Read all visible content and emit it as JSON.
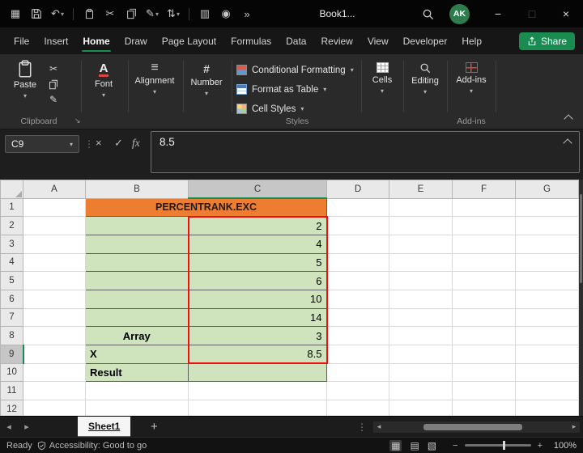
{
  "colors": {
    "accent_green": "#1a8c52",
    "cell_green": "#cfe3bd",
    "cell_orange": "#ed7d31",
    "range_red": "#ee1111"
  },
  "icons": {
    "dropdown": "▾",
    "overflow": "»",
    "ellipsis_v": "⋮",
    "minimize": "−",
    "maximize": "□",
    "close": "×",
    "cancel": "×",
    "enter": "✓",
    "undo": "↶",
    "cut": "✂",
    "sort": "⇅",
    "pencil": "✎",
    "window": "▦",
    "table": "▥",
    "camera": "◉",
    "prev": "◂",
    "next": "▸",
    "plus": "+",
    "zoom_out": "−",
    "zoom_in": "+",
    "view_normal": "▦",
    "view_layout": "▤",
    "view_break": "▧",
    "launcher": "↘",
    "align": "≡",
    "number": "#",
    "font": "A"
  },
  "titlebar": {
    "title": "Book1...",
    "avatar_initials": "AK"
  },
  "menubar": {
    "tabs": [
      "File",
      "Insert",
      "Home",
      "Draw",
      "Page Layout",
      "Formulas",
      "Data",
      "Review",
      "View",
      "Developer",
      "Help"
    ],
    "active_tab": "Home",
    "share_label": "Share"
  },
  "ribbon": {
    "paste_label": "Paste",
    "font_label": "Font",
    "alignment_label": "Alignment",
    "number_label": "Number",
    "styles": {
      "conditional_formatting": "Conditional Formatting",
      "format_as_table": "Format as Table",
      "cell_styles": "Cell Styles"
    },
    "cells_label": "Cells",
    "editing_label": "Editing",
    "addins_label": "Add-ins",
    "group_labels": {
      "clipboard": "Clipboard",
      "styles": "Styles",
      "addins": "Add-ins"
    }
  },
  "formula_bar": {
    "name_box": "C9",
    "fx_label": "fx",
    "content": "8.5"
  },
  "sheet": {
    "columns": [
      "A",
      "B",
      "C",
      "D",
      "E",
      "F",
      "G"
    ],
    "rows": [
      "1",
      "2",
      "3",
      "4",
      "5",
      "6",
      "7",
      "8",
      "9",
      "10",
      "11",
      "12"
    ],
    "active_cell": "C9",
    "cells": {
      "title": "PERCENTRANK.EXC",
      "array_label": "Array",
      "x_label": "X",
      "result_label": "Result",
      "values": [
        "2",
        "4",
        "5",
        "6",
        "10",
        "14",
        "3",
        "8.5"
      ]
    }
  },
  "sheet_bar": {
    "tab": "Sheet1"
  },
  "status_bar": {
    "mode": "Ready",
    "accessibility": "Accessibility: Good to go",
    "zoom": "100%"
  }
}
